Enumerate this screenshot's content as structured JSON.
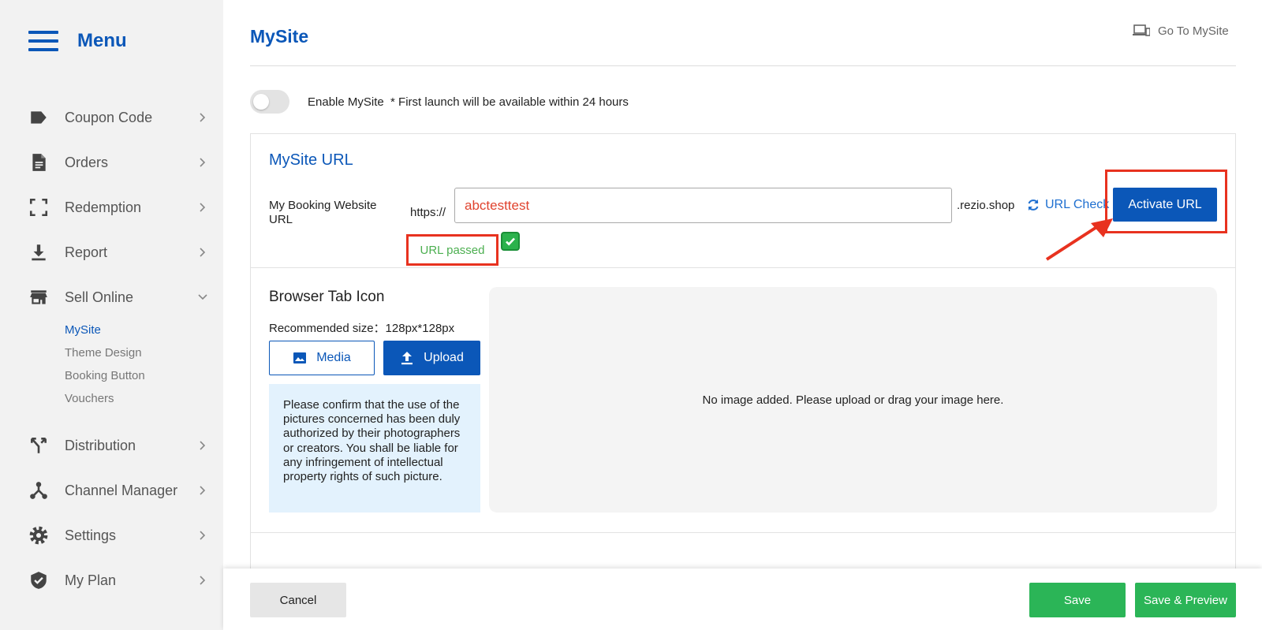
{
  "sidebar": {
    "title": "Menu",
    "items": [
      {
        "label": "Coupon Code",
        "icon": "tag-icon"
      },
      {
        "label": "Orders",
        "icon": "document-icon"
      },
      {
        "label": "Redemption",
        "icon": "scan-frame-icon"
      },
      {
        "label": "Report",
        "icon": "download-icon"
      },
      {
        "label": "Sell Online",
        "icon": "store-icon"
      },
      {
        "label": "Distribution",
        "icon": "fork-icon"
      },
      {
        "label": "Channel Manager",
        "icon": "network-icon"
      },
      {
        "label": "Settings",
        "icon": "gear-icon"
      },
      {
        "label": "My Plan",
        "icon": "shield-check-icon"
      }
    ],
    "sell_online_sub": [
      "MySite",
      "Theme Design",
      "Booking Button",
      "Vouchers"
    ]
  },
  "header": {
    "title": "MySite",
    "goto_label": "Go To MySite"
  },
  "enable": {
    "label": "Enable MySite  * First launch will be available within 24 hours",
    "enabled": false
  },
  "url_section": {
    "title": "MySite URL",
    "field_label": "My Booking Website URL",
    "prefix": "https://",
    "value": "abctesttest",
    "suffix": ".rezio.shop",
    "check_label": "URL Check",
    "activate_label": "Activate URL",
    "status": "URL passed"
  },
  "icon_section": {
    "title": "Browser Tab Icon",
    "recommended": "Recommended size：128px*128px",
    "media_label": "Media",
    "upload_label": "Upload",
    "notice": "Please confirm that the use of the pictures concerned has been duly authorized by their photographers or creators. You shall be liable for any infringement of intellectual property rights of such picture.",
    "dropzone_text": "No image added. Please upload or drag your image here."
  },
  "footer": {
    "cancel_label": "Cancel",
    "save_label": "Save",
    "save_preview_label": "Save & Preview"
  },
  "colors": {
    "brand_blue": "#0b57b8",
    "success_green": "#2bb557",
    "highlight_red": "#e8321f",
    "error_text": "#e0432e"
  }
}
